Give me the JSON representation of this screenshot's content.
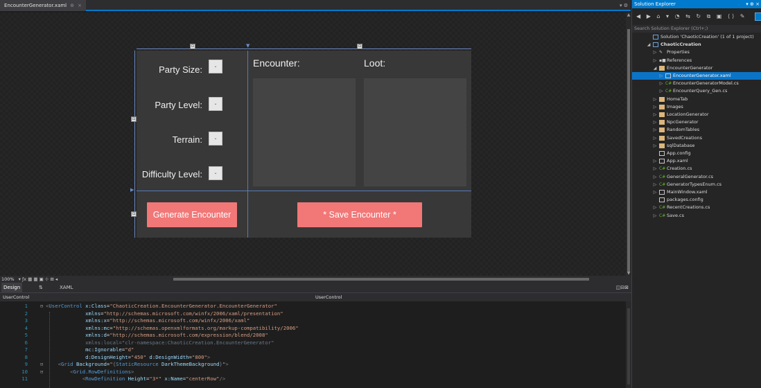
{
  "document_tab": {
    "title": "EncounterGenerator.xaml",
    "pin": "⊕",
    "close": "×",
    "controls": "▾ ⚙"
  },
  "designer": {
    "party_size_label": "Party Size:",
    "party_level_label": "Party Level:",
    "terrain_label": "Terrain:",
    "difficulty_label": "Difficulty Level:",
    "encounter_header": "Encounter:",
    "loot_header": "Loot:",
    "generate_button": "Generate Encounter",
    "save_button": "* Save Encounter *",
    "dropdown_glyph": "⌄"
  },
  "zoom_bar": {
    "zoom": "100%"
  },
  "split_bar": {
    "design_tab": "Design",
    "swap": "⇅",
    "xaml_tab": "XAML",
    "view_controls": "◫⊟⊠"
  },
  "nav_bar": {
    "left": "UserControl",
    "middle": "UserControl"
  },
  "code": {
    "lines": [
      {
        "n": "1",
        "fold": "⊟",
        "html": "<span class=\"t-br\">&lt;</span><span class=\"t-tag\">UserControl</span> <span class=\"t-attr\">x:Class</span>=<span class=\"t-str\">\"ChaoticCreation.EncounterGenerator.EncounterGenerator\"</span>"
      },
      {
        "n": "2",
        "fold": "",
        "html": "             <span class=\"t-attr\">xmlns</span>=<span class=\"t-str\">\"http://schemas.microsoft.com/winfx/2006/xaml/presentation\"</span>"
      },
      {
        "n": "3",
        "fold": "",
        "html": "             <span class=\"t-attr\">xmlns:x</span>=<span class=\"t-str\">\"http://schemas.microsoft.com/winfx/2006/xaml\"</span>"
      },
      {
        "n": "4",
        "fold": "",
        "html": "             <span class=\"t-attr\">xmlns:mc</span>=<span class=\"t-str\">\"http://schemas.openxmlformats.org/markup-compatibility/2006\"</span>"
      },
      {
        "n": "5",
        "fold": "",
        "html": "             <span class=\"t-attr\">xmlns:d</span>=<span class=\"t-str\">\"http://schemas.microsoft.com/expression/blend/2008\"</span>"
      },
      {
        "n": "6",
        "fold": "",
        "html": "             <span class=\"t-dim\">xmlns:local=\"clr-namespace:ChaoticCreation.EncounterGenerator\"</span>"
      },
      {
        "n": "7",
        "fold": "",
        "html": "             <span class=\"t-attr\">mc:Ignorable</span>=<span class=\"t-str\">\"d\"</span>"
      },
      {
        "n": "8",
        "fold": "",
        "html": "             <span class=\"t-attr\">d:DesignHeight</span>=<span class=\"t-str\">\"450\"</span> <span class=\"t-attr\">d:DesignWidth</span>=<span class=\"t-str\">\"800\"</span><span class=\"t-br\">&gt;</span>"
      },
      {
        "n": "9",
        "fold": "⊟",
        "html": "    <span class=\"t-br\">&lt;</span><span class=\"t-tag\">Grid</span> <span class=\"t-attr\">Background</span>=<span class=\"t-str\">\"</span><span class=\"t-br\">{</span><span class=\"t-tag\">StaticResource</span> <span class=\"t-attr\">DarkThemeBackground</span><span class=\"t-br\">}</span><span class=\"t-str\">\"</span><span class=\"t-br\">&gt;</span>"
      },
      {
        "n": "10",
        "fold": "⊟",
        "html": "        <span class=\"t-br\">&lt;</span><span class=\"t-tag\">Grid.RowDefinitions</span><span class=\"t-br\">&gt;</span>"
      },
      {
        "n": "11",
        "fold": "",
        "html": "            <span class=\"t-br\">&lt;</span><span class=\"t-tag\">RowDefinition</span> <span class=\"t-attr\">Height</span>=<span class=\"t-str\">\"3*\"</span> <span class=\"t-attr\">x:Name</span>=<span class=\"t-str\">\"centerRow\"</span><span class=\"t-br\">/&gt;</span>"
      }
    ]
  },
  "solution_explorer": {
    "title": "Solution Explorer",
    "title_controls": "▾ ⊕ ×",
    "toolbar": "◀ ▶ ⌂ ▾ ◔ ⇆ ↻ ⧉ ▣ ⟨⟩ ✎",
    "search_placeholder": "Search Solution Explorer (Ctrl+;)",
    "items": [
      {
        "label": "Solution 'ChaoticCreation' (1 of 1 project)",
        "depth": 0,
        "arrow": "",
        "icon": "solution-icon",
        "bold": false,
        "selected": false
      },
      {
        "label": "ChaoticCreation",
        "depth": 0,
        "arrow": "◢",
        "icon": "project-icon",
        "bold": true,
        "selected": false
      },
      {
        "label": "Properties",
        "depth": 1,
        "arrow": "▷",
        "icon": "wrench-icon",
        "bold": false,
        "selected": false
      },
      {
        "label": "References",
        "depth": 1,
        "arrow": "▷",
        "icon": "references-icon",
        "bold": false,
        "selected": false
      },
      {
        "label": "EncounterGenerator",
        "depth": 1,
        "arrow": "◢",
        "icon": "folder-open-icon",
        "bold": false,
        "selected": false
      },
      {
        "label": "EncounterGenerator.xaml",
        "depth": 2,
        "arrow": "▷",
        "icon": "xaml-file-icon",
        "bold": false,
        "selected": true
      },
      {
        "label": "EncounterGeneratorModel.cs",
        "depth": 2,
        "arrow": "▷",
        "icon": "csharp-file-icon",
        "bold": false,
        "selected": false
      },
      {
        "label": "EncounterQuery_Gen.cs",
        "depth": 2,
        "arrow": "▷",
        "icon": "csharp-file-icon",
        "bold": false,
        "selected": false
      },
      {
        "label": "HomeTab",
        "depth": 1,
        "arrow": "▷",
        "icon": "folder-icon",
        "bold": false,
        "selected": false
      },
      {
        "label": "Images",
        "depth": 1,
        "arrow": "▷",
        "icon": "folder-icon",
        "bold": false,
        "selected": false
      },
      {
        "label": "LocationGenerator",
        "depth": 1,
        "arrow": "▷",
        "icon": "folder-icon",
        "bold": false,
        "selected": false
      },
      {
        "label": "NpcGenerator",
        "depth": 1,
        "arrow": "▷",
        "icon": "folder-icon",
        "bold": false,
        "selected": false
      },
      {
        "label": "RandomTables",
        "depth": 1,
        "arrow": "▷",
        "icon": "folder-icon",
        "bold": false,
        "selected": false
      },
      {
        "label": "SavedCreations",
        "depth": 1,
        "arrow": "▷",
        "icon": "folder-icon",
        "bold": false,
        "selected": false
      },
      {
        "label": "sqlDatabase",
        "depth": 1,
        "arrow": "▷",
        "icon": "folder-icon",
        "bold": false,
        "selected": false
      },
      {
        "label": "App.config",
        "depth": 1,
        "arrow": "",
        "icon": "config-file-icon",
        "bold": false,
        "selected": false
      },
      {
        "label": "App.xaml",
        "depth": 1,
        "arrow": "▷",
        "icon": "xaml-file-icon",
        "bold": false,
        "selected": false
      },
      {
        "label": "Creation.cs",
        "depth": 1,
        "arrow": "▷",
        "icon": "csharp-file-icon",
        "bold": false,
        "selected": false
      },
      {
        "label": "GeneralGenerator.cs",
        "depth": 1,
        "arrow": "▷",
        "icon": "csharp-file-icon",
        "bold": false,
        "selected": false
      },
      {
        "label": "GeneratorTypesEnum.cs",
        "depth": 1,
        "arrow": "▷",
        "icon": "csharp-file-icon",
        "bold": false,
        "selected": false
      },
      {
        "label": "MainWindow.xaml",
        "depth": 1,
        "arrow": "▷",
        "icon": "xaml-file-icon",
        "bold": false,
        "selected": false
      },
      {
        "label": "packages.config",
        "depth": 1,
        "arrow": "",
        "icon": "config-file-icon",
        "bold": false,
        "selected": false
      },
      {
        "label": "RecentCreations.cs",
        "depth": 1,
        "arrow": "▷",
        "icon": "csharp-file-icon",
        "bold": false,
        "selected": false
      },
      {
        "label": "Save.cs",
        "depth": 1,
        "arrow": "▷",
        "icon": "csharp-file-icon",
        "bold": false,
        "selected": false
      }
    ]
  },
  "colors": {
    "accent": "#007acc",
    "button": "#f27777",
    "control_bg": "#383838",
    "panel_bg": "#444444",
    "selection": "#0b74c7"
  }
}
